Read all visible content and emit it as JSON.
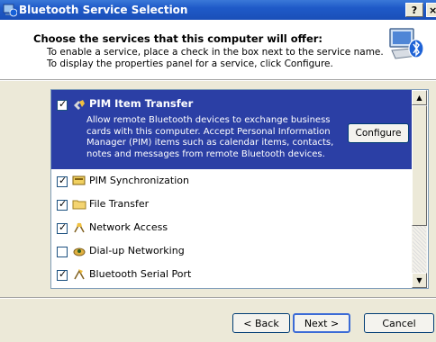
{
  "window": {
    "title": "Bluetooth Service Selection",
    "help_label": "?",
    "close_label": "×"
  },
  "header": {
    "heading": "Choose the services that this computer will offer:",
    "line1": "To enable a service, place a check in the box next to the service name.",
    "line2": "To display the properties panel for a service, click Configure."
  },
  "services": [
    {
      "label": "PIM Item Transfer",
      "checked": true,
      "selected": true,
      "icon": "pim-transfer-icon",
      "description": "Allow remote Bluetooth devices to exchange business cards with this computer. Accept Personal Information Manager (PIM) items such as calendar items, contacts, notes and messages from remote Bluetooth devices.",
      "configure_label": "Configure"
    },
    {
      "label": "PIM Synchronization",
      "checked": true,
      "icon": "sync-icon"
    },
    {
      "label": "File Transfer",
      "checked": true,
      "icon": "folder-icon"
    },
    {
      "label": "Network Access",
      "checked": true,
      "icon": "network-icon"
    },
    {
      "label": "Dial-up Networking",
      "checked": false,
      "icon": "dialup-icon"
    },
    {
      "label": "Bluetooth Serial Port",
      "checked": true,
      "icon": "serial-port-icon"
    }
  ],
  "footer": {
    "back_label": "< Back",
    "next_label": "Next >",
    "cancel_label": "Cancel"
  }
}
